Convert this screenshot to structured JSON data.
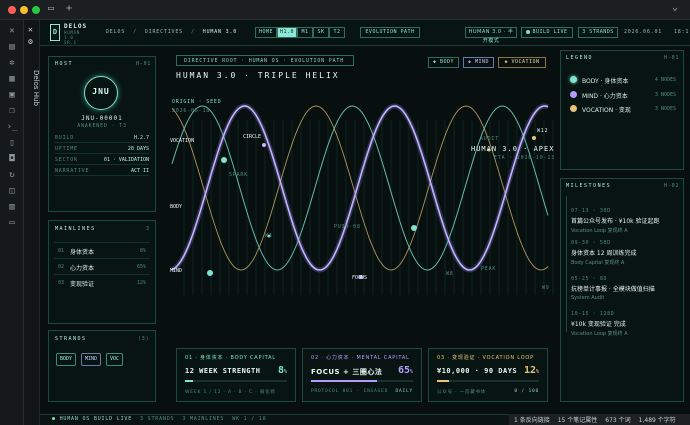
{
  "window": {
    "new_tab": "+"
  },
  "hub": {
    "title": "Delos Hub"
  },
  "header": {
    "logo_letter": "D",
    "brand": "DELOS",
    "brand_sub": [
      "HUMAN",
      "1.0",
      "SR.1"
    ],
    "breadcrumb": [
      "DELOS",
      "/",
      "DIRECTIVES",
      "/",
      "HUMAN 3.0"
    ],
    "view_tabs": [
      "HOME",
      "H1.0",
      "M1",
      "SK",
      "T2"
    ],
    "active_tab": 1,
    "evolution_button": "EVOLUTION PATH",
    "mode_button": "HUMAN 3.0 · 半开模式",
    "build_status": "BUILD LIVE",
    "strands_count": "3 STRANDS",
    "date": "2026.06.01",
    "time": "18:1"
  },
  "host": {
    "title": "HOST",
    "code": "H-01",
    "avatar": "JNU",
    "id": "JNU-00001",
    "status": "AWAKENED · T3",
    "rows": [
      {
        "k": "BUILD",
        "v": "H.2.7"
      },
      {
        "k": "UPTIME",
        "v": "20 DAYS"
      },
      {
        "k": "SECTOR",
        "v": "01 · VALIDATION"
      },
      {
        "k": "NARRATIVE",
        "v": "ACT II"
      }
    ]
  },
  "mainlines": {
    "title": "MAINLINES",
    "count": "3",
    "items": [
      {
        "idx": "01",
        "label": "身体资本",
        "pct": "8%"
      },
      {
        "idx": "02",
        "label": "心力资本",
        "pct": "65%"
      },
      {
        "idx": "03",
        "label": "变现验证",
        "pct": "12%"
      }
    ]
  },
  "strands": {
    "title": "STRANDS",
    "count": "(3)",
    "chips": [
      "BODY",
      "MIND",
      "VOC"
    ]
  },
  "center": {
    "path_label": "DIRECTIVE ROOT · HUMAN OS · EVOLUTION PATH",
    "title": "HUMAN 3.0 · TRIPLE HELIX",
    "origin_label": "ORIGIN · SEED",
    "origin_date": "2026-05-18",
    "apex_label": "HUMAN 3.0 · APEX",
    "apex_date": "ETA · 2026-10-13",
    "filters": [
      "BODY",
      "MIND",
      "VOCATION"
    ],
    "row_labels": [
      "VOCATION",
      "BODY",
      "MIND"
    ],
    "markers": [
      "CIRCLE",
      "SPARK",
      "W3",
      "PUSH·08",
      "FOCUS",
      "W8",
      "AUDIT",
      "W12",
      "PEAK",
      "W9"
    ]
  },
  "cards": [
    {
      "head": "01 · 身体资本 · BODY CAPITAL",
      "value": "12 WEEK STRENGTH",
      "pct": "8",
      "unit": "%",
      "progress": 0.08,
      "foot": "WEEK 1 / 12 · A · B · C · 弱化修",
      "right": "",
      "color": "#7fe3cf"
    },
    {
      "head": "02 · 心力资本 · MENTAL CAPITAL",
      "value": "FOCUS + 三圈心法",
      "pct": "65",
      "unit": "%",
      "progress": 0.65,
      "foot": "PROTOCOL 001 · ENGAGED",
      "right": "DAILY",
      "color": "#b49cff"
    },
    {
      "head": "03 · 变现验证 · VOCATION LOOP",
      "value": "¥10,000 · 90 DAYS",
      "pct": "12",
      "unit": "%",
      "progress": 0.12,
      "foot": "公众号 · 一首藏书体",
      "right": "0 / 100",
      "color": "#e6c27a"
    }
  ],
  "legend": {
    "title": "LEGEND",
    "code": "H-01",
    "items": [
      {
        "label": "BODY · 身体资本",
        "n": "4 NODES",
        "color": "#7fe3cf"
      },
      {
        "label": "MIND · 心力资本",
        "n": "3 NODES",
        "color": "#b49cff"
      },
      {
        "label": "VOCATION · 变现",
        "n": "3 NODES",
        "color": "#e6c27a"
      }
    ]
  },
  "milestones": {
    "title": "MILESTONES",
    "code": "H-02",
    "items": [
      {
        "date": "07-13 · 30D",
        "title": "首篇公众号发布 · ¥10k 验证起跑",
        "sub": "Vocation Loop 复现终 A"
      },
      {
        "date": "09-30 · 58D",
        "title": "身体资本 12 周训练完成",
        "sub": "Body Capital 复现终 A"
      },
      {
        "date": "05-25 · 8D",
        "title": "抗榜单计事报 · 全模块做值扫描",
        "sub": "System Audit"
      },
      {
        "date": "10-15 · 128D",
        "title": "¥10k 变现验证 完成",
        "sub": "Vocation Loop 复现终 A"
      }
    ]
  },
  "statusbar": {
    "build": "HUMAN OS BUILD LIVE",
    "strands": "3 STRANDS",
    "mainlines": "3 MAINLINES",
    "week": "WK 1 / 18",
    "backlinks": "1 条反向链接",
    "props": "15 个笔记属性",
    "words": "673 个词",
    "chars": "1,489 个字符"
  }
}
